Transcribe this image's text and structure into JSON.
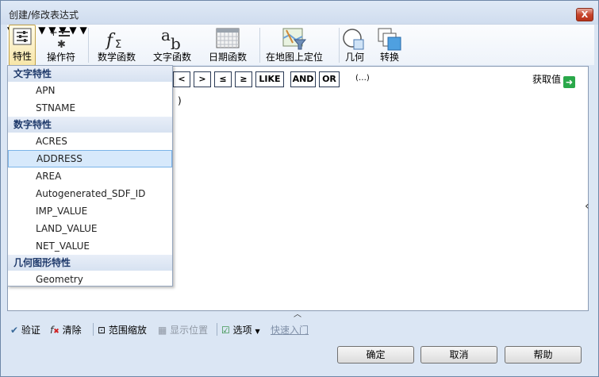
{
  "window": {
    "title": "创建/修改表达式",
    "close_label": "X"
  },
  "toolbar": {
    "property": "特性",
    "operator": "操作符",
    "math": "数学函数",
    "text": "文字函数",
    "date": "日期函数",
    "locate": "在地图上定位",
    "geometry": "几何",
    "convert": "转换"
  },
  "operators": [
    "<",
    ">",
    "≤",
    "≥",
    "LIKE",
    "AND",
    "OR"
  ],
  "ellipsis": "(…)",
  "get_value": "获取值",
  "expression": ")",
  "dropdown": {
    "groups": [
      {
        "header": "文字特性",
        "items": [
          "APN",
          "STNAME"
        ]
      },
      {
        "header": "数字特性",
        "items": [
          "ACRES",
          "ADDRESS",
          "AREA",
          "Autogenerated_SDF_ID",
          "IMP_VALUE",
          "LAND_VALUE",
          "NET_VALUE"
        ]
      },
      {
        "header": "几何图形特性",
        "items": [
          "Geometry"
        ]
      }
    ],
    "selected": "ADDRESS"
  },
  "statusbar": {
    "validate": "验证",
    "clear": "清除",
    "zoom_extent": "范围缩放",
    "show_position": "显示位置",
    "options": "选项",
    "quick_start": "快速入门"
  },
  "buttons": {
    "ok": "确定",
    "cancel": "取消",
    "help": "帮助"
  }
}
